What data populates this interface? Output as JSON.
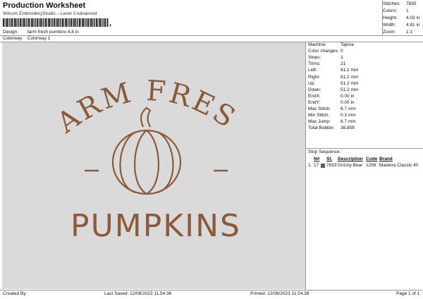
{
  "header": {
    "title": "Production Worksheet",
    "subtitle": "Wilcom EmbroideryStudio – Level 3 Advanced",
    "barcode_suffix": ",",
    "design_label": "Design:",
    "design_value": "farm fresh pumkins 4,8 in",
    "colorway_label": "Colorway:",
    "colorway_value": "Colorway 1"
  },
  "top_stats": [
    {
      "label": "Stitches:",
      "value": "7835"
    },
    {
      "label": "Colors:",
      "value": "1"
    },
    {
      "label": "Height:",
      "value": "4.03 in"
    },
    {
      "label": "Width:",
      "value": "4.81 in"
    },
    {
      "label": "Zoom:",
      "value": "1:1"
    }
  ],
  "properties": [
    {
      "label": "Machine:",
      "value": "Tajima"
    },
    {
      "label": "Color changes:",
      "value": "0"
    },
    {
      "label": "Stops:",
      "value": "1"
    },
    {
      "label": "Trims:",
      "value": "21"
    },
    {
      "label": "Left:",
      "value": "61.1 mm"
    },
    {
      "label": "Right:",
      "value": "61.2 mm"
    },
    {
      "label": "Up:",
      "value": "51.2 mm"
    },
    {
      "label": "Down:",
      "value": "51.2 mm"
    },
    {
      "label": "EndX:",
      "value": "0.00 in"
    },
    {
      "label": "EndY:",
      "value": "0.00 in"
    },
    {
      "label": "Max Stitch:",
      "value": "6.7 mm"
    },
    {
      "label": "Min Stitch:",
      "value": "0.3 mm"
    },
    {
      "label": "Max Jump:",
      "value": "6.7 mm"
    },
    {
      "label": "Total Bobbin:",
      "value": "38.85ft"
    }
  ],
  "stop_sequence": {
    "title": "Stop Sequence:",
    "headers": {
      "n": "N#",
      "st": "St.",
      "description": "Description",
      "code": "Code",
      "brand": "Brand"
    },
    "rows": [
      {
        "idx": "1.",
        "n": "17",
        "swatch_color": "#8a5a3b",
        "st": "7833",
        "description": "Grizzly Bear",
        "code": "1258",
        "brand": "Madeira Classic 40"
      }
    ]
  },
  "design_preview": {
    "line1": "FARM FRESH",
    "line2": "PUMPKINS",
    "thread_color": "#8a5a3b",
    "fabric_color": "#dadada"
  },
  "footer": {
    "created_by": "Created By:",
    "last_saved": "Last Saved: 12/08/2023 11.54.36",
    "printed": "Printed: 12/08/2023 11.54.38",
    "page": "Page 1 of 1"
  }
}
